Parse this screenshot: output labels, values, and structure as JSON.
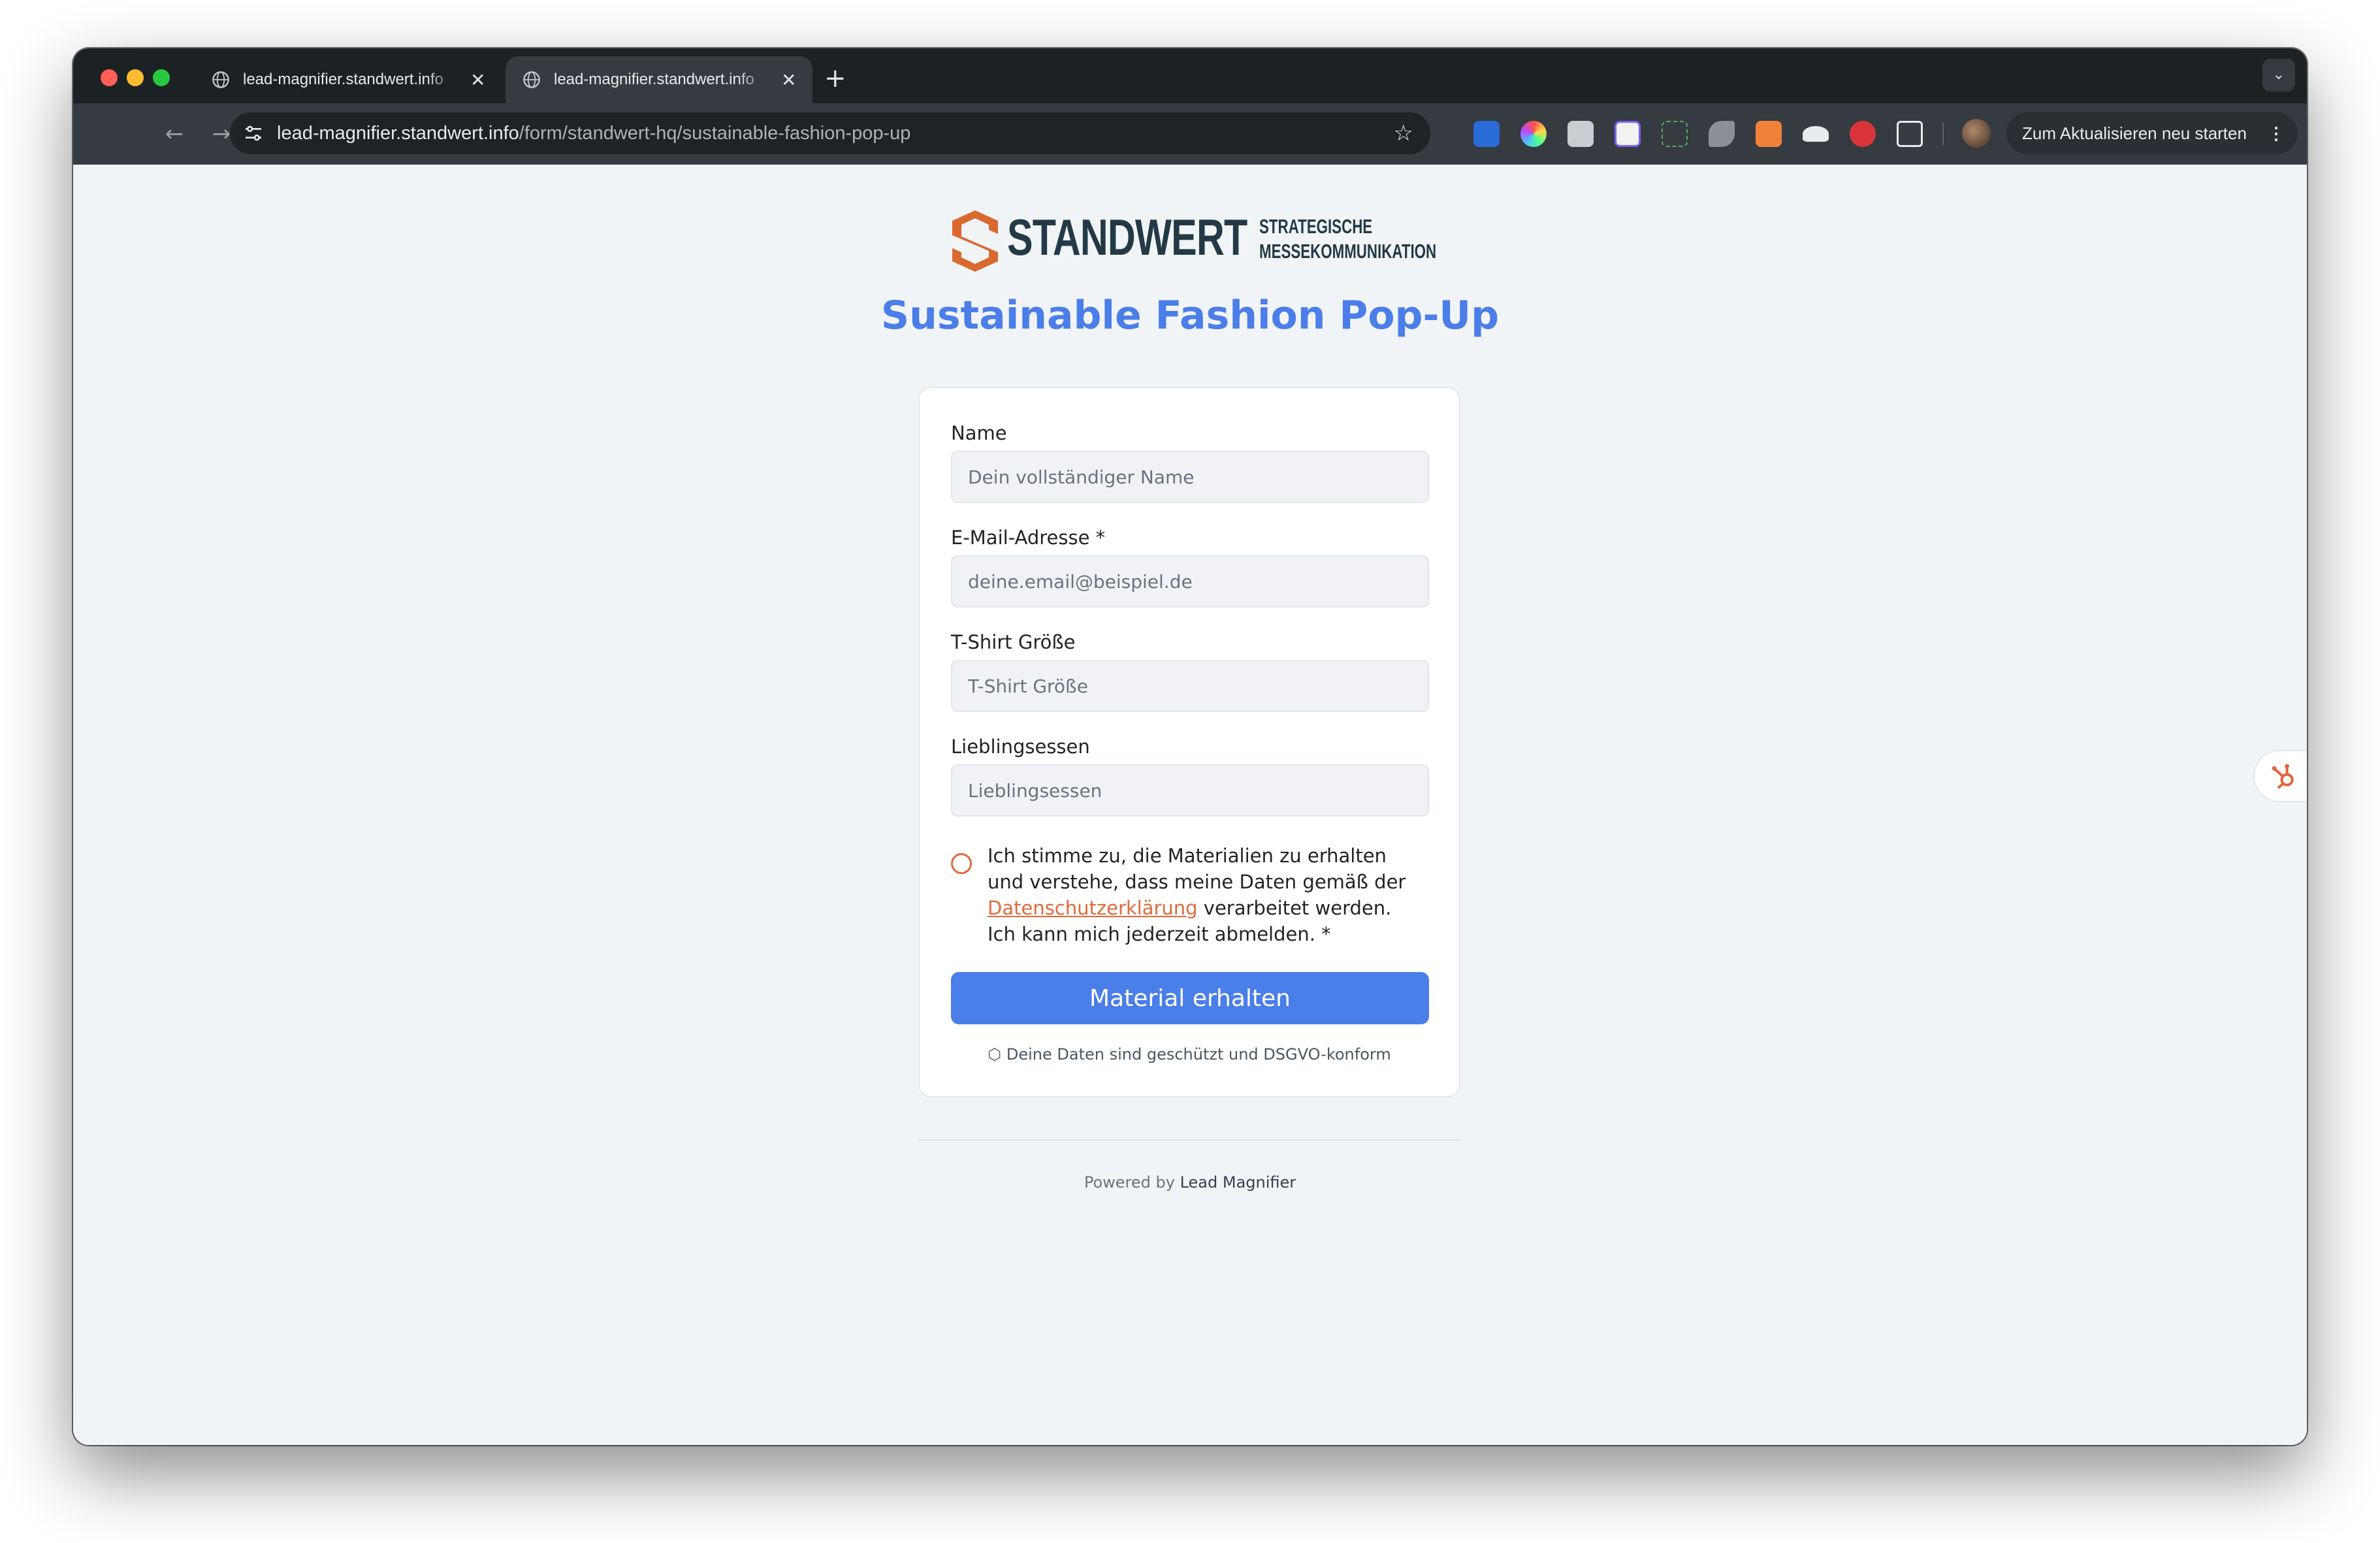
{
  "browser": {
    "tabs": [
      {
        "title": "lead-magnifier.standwert.info"
      },
      {
        "title": "lead-magnifier.standwert.info"
      }
    ],
    "address": {
      "host": "lead-magnifier.standwert.info",
      "path": "/form/standwert-hq/sustainable-fashion-pop-up"
    },
    "relaunch_label": "Zum Aktualisieren neu starten",
    "extensions": [
      "bitwarden-icon",
      "color-picker-icon",
      "notes-icon",
      "clickup-icon",
      "screenshot-icon",
      "puzzle-arrow-icon",
      "hubspot-icon",
      "cloud-icon",
      "adblock-icon",
      "extensions-icon"
    ]
  },
  "logo": {
    "wordmark": "STANDWERT",
    "tagline_line1": "STRATEGISCHE",
    "tagline_line2": "MESSEKOMMUNIKATION"
  },
  "page": {
    "title": "Sustainable Fashion Pop-Up"
  },
  "form": {
    "fields": [
      {
        "label": "Name",
        "placeholder": "Dein vollständiger Name",
        "value": ""
      },
      {
        "label": "E-Mail-Adresse *",
        "placeholder": "deine.email@beispiel.de",
        "value": ""
      },
      {
        "label": "T-Shirt Größe",
        "placeholder": "T-Shirt Größe",
        "value": ""
      },
      {
        "label": "Lieblingsessen",
        "placeholder": "Lieblingsessen",
        "value": ""
      }
    ],
    "consent": {
      "text_before": "Ich stimme zu, die Materialien zu erhalten und verstehe, dass meine Daten gemäß der ",
      "link_text": "Datenschutzerklärung",
      "text_after": " verarbeitet werden. Ich kann mich jederzeit abmelden. *"
    },
    "submit_label": "Material erhalten",
    "security_note": "Deine Daten sind geschützt und DSGVO-konform"
  },
  "footer": {
    "powered_prefix": "Powered by",
    "brand": "Lead Magnifier"
  },
  "colors": {
    "accent": "#4a7ee8",
    "consent_link": "#e06a3a",
    "logo_orange": "#d9692e",
    "logo_navy": "#233a46"
  }
}
